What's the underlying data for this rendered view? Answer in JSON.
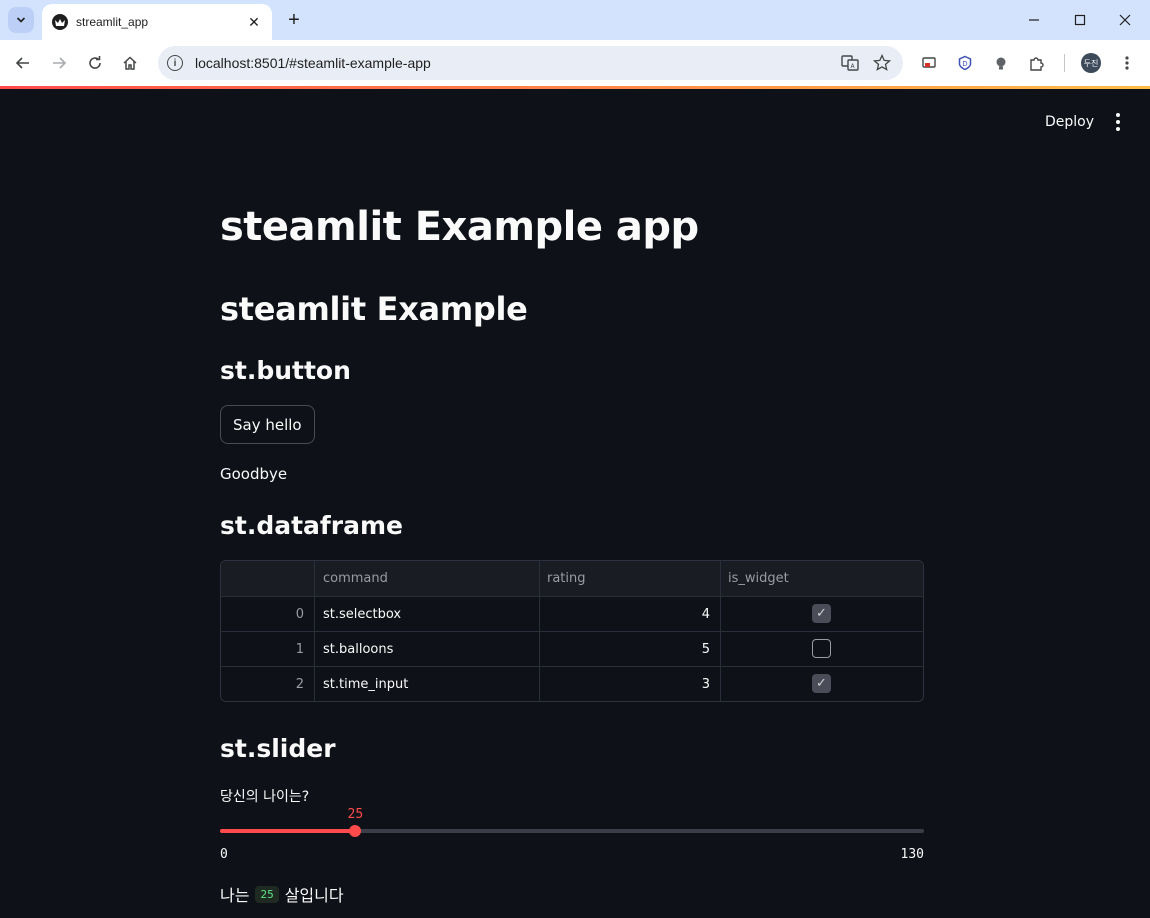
{
  "browser": {
    "tab_title": "streamlit_app",
    "url": "localhost:8501/#steamlit-example-app",
    "profile_initials": "두진"
  },
  "app": {
    "deploy_label": "Deploy",
    "title": "steamlit Example app",
    "header": "steamlit Example",
    "button_section": {
      "heading": "st.button",
      "button_label": "Say hello",
      "output": "Goodbye"
    },
    "dataframe_section": {
      "heading": "st.dataframe",
      "columns": [
        "",
        "command",
        "rating",
        "is_widget"
      ],
      "rows": [
        {
          "index": "0",
          "command": "st.selectbox",
          "rating": "4",
          "is_widget": true
        },
        {
          "index": "1",
          "command": "st.balloons",
          "rating": "5",
          "is_widget": false
        },
        {
          "index": "2",
          "command": "st.time_input",
          "rating": "3",
          "is_widget": true
        }
      ]
    },
    "slider_section": {
      "heading": "st.slider",
      "label": "당신의 나이는?",
      "min": 0,
      "max": 130,
      "value": 25,
      "min_label": "0",
      "max_label": "130",
      "value_label": "25",
      "result_prefix": "나는",
      "result_value": "25",
      "result_suffix": "살입니다"
    }
  },
  "colors": {
    "accent": "#ff4b4b",
    "background": "#0e1117",
    "text": "#fafafa"
  }
}
